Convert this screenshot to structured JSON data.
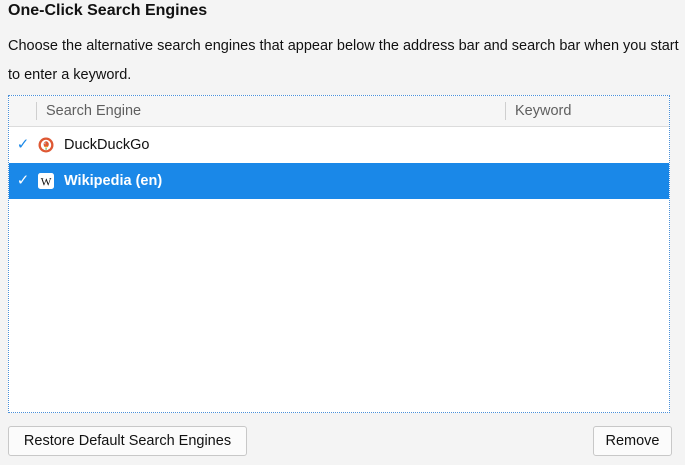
{
  "section": {
    "title": "One-Click Search Engines",
    "description": "Choose the alternative search engines that appear below the address bar and search bar when you start to enter a keyword."
  },
  "table": {
    "columns": {
      "engine": "Search Engine",
      "keyword": "Keyword"
    },
    "rows": [
      {
        "checked": true,
        "check_glyph": "✓",
        "name": "DuckDuckGo",
        "keyword": "",
        "icon": "duckduckgo-icon",
        "selected": false
      },
      {
        "checked": true,
        "check_glyph": "✓",
        "name": "Wikipedia (en)",
        "keyword": "",
        "icon": "wikipedia-icon",
        "selected": true
      }
    ]
  },
  "buttons": {
    "restore": "Restore Default Search Engines",
    "remove": "Remove"
  },
  "colors": {
    "selection": "#1a88e8",
    "check": "#1a88e8",
    "focus_border": "#4a90d9"
  }
}
